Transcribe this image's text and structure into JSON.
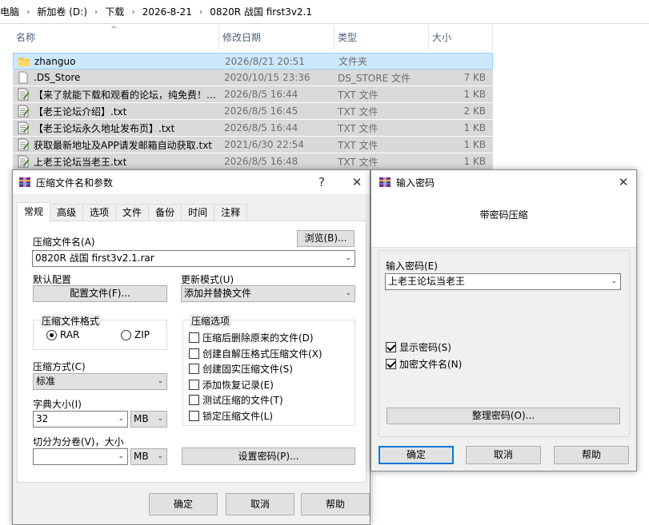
{
  "breadcrumb": [
    "此电脑",
    "新加卷 (D:)",
    "下载",
    "2026-8-21",
    "0820R 战国 first3v2.1"
  ],
  "columns": {
    "name": "名称",
    "date": "修改日期",
    "type": "类型",
    "size": "大小"
  },
  "files": [
    {
      "name": "zhanguo",
      "date": "2026/8/21 20:51",
      "type": "文件夹",
      "size": "",
      "icon": "folder-icon",
      "selected": true
    },
    {
      "name": ".DS_Store",
      "date": "2020/10/15 23:36",
      "type": "DS_STORE 文件",
      "size": "7 KB",
      "icon": "file-icon"
    },
    {
      "name": "【来了就能下载和观看的论坛，纯免费！…",
      "date": "2026/8/5 16:44",
      "type": "TXT 文件",
      "size": "1 KB",
      "icon": "text-file-icon"
    },
    {
      "name": "【老王论坛介绍】.txt",
      "date": "2026/8/5 16:45",
      "type": "TXT 文件",
      "size": "2 KB",
      "icon": "text-file-icon"
    },
    {
      "name": "【老王论坛永久地址发布页】.txt",
      "date": "2026/8/5 16:44",
      "type": "TXT 文件",
      "size": "1 KB",
      "icon": "text-file-icon"
    },
    {
      "name": "获取最新地址及APP请发邮箱自动获取.txt",
      "date": "2021/6/30 22:54",
      "type": "TXT 文件",
      "size": "1 KB",
      "icon": "text-file-icon"
    },
    {
      "name": "上老王论坛当老王.txt",
      "date": "2026/8/5 16:48",
      "type": "TXT 文件",
      "size": "1 KB",
      "icon": "text-file-icon"
    }
  ],
  "archive_dialog": {
    "title": "压缩文件名和参数",
    "help_glyph": "?",
    "close_glyph": "✕",
    "tabs": [
      "常规",
      "高级",
      "选项",
      "文件",
      "备份",
      "时间",
      "注释"
    ],
    "archive_name_label": "压缩文件名(A)",
    "browse_button": "浏览(B)...",
    "archive_name_value": "0820R 战国 first3v2.1.rar",
    "default_profile_label": "默认配置",
    "profiles_button": "配置文件(F)...",
    "update_mode_label": "更新模式(U)",
    "update_mode_value": "添加并替换文件",
    "format_group": "压缩文件格式",
    "format_rar": "RAR",
    "format_zip": "ZIP",
    "selected_format": "RAR",
    "method_label": "压缩方式(C)",
    "method_value": "标准",
    "dict_label": "字典大小(I)",
    "dict_value": "32",
    "dict_unit": "MB",
    "split_label": "切分为分卷(V)，大小",
    "split_value": "",
    "split_unit": "MB",
    "options_group": "压缩选项",
    "options": [
      {
        "label": "压缩后删除原来的文件(D)",
        "checked": false
      },
      {
        "label": "创建自解压格式压缩文件(X)",
        "checked": false
      },
      {
        "label": "创建固实压缩文件(S)",
        "checked": false
      },
      {
        "label": "添加恢复记录(E)",
        "checked": false
      },
      {
        "label": "测试压缩的文件(T)",
        "checked": false
      },
      {
        "label": "锁定压缩文件(L)",
        "checked": false
      }
    ],
    "set_password_button": "设置密码(P)...",
    "ok_button": "确定",
    "cancel_button": "取消",
    "help_button": "帮助"
  },
  "password_dialog": {
    "title": "输入密码",
    "close_glyph": "✕",
    "heading": "带密码压缩",
    "password_label": "输入密码(E)",
    "password_value": "上老王论坛当老王",
    "show_password": {
      "label": "显示密码(S)",
      "checked": true
    },
    "encrypt_names": {
      "label": "加密文件名(N)",
      "checked": true
    },
    "organize_button": "整理密码(O)...",
    "ok_button": "确定",
    "cancel_button": "取消",
    "help_button": "帮助"
  },
  "colors": {
    "accent": "#0078d7",
    "selection": "#cce8ff",
    "dialog_bg": "#f0f0f0"
  }
}
